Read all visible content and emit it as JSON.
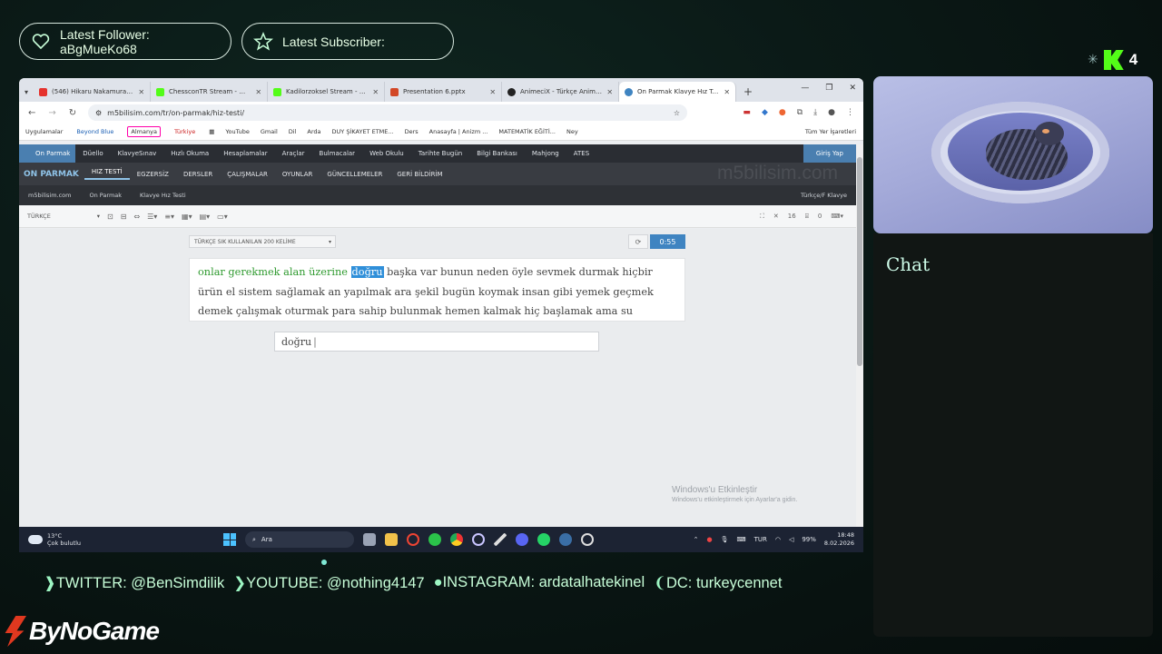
{
  "overlay": {
    "follower": {
      "label": "Latest Follower:",
      "value": "aBgMueKo68"
    },
    "subscriber": {
      "label": "Latest Subscriber:",
      "value": ""
    },
    "kick": {
      "count": "4"
    },
    "socials": [
      {
        "icon": "twitter-icon",
        "text": "TWITTER: @BenSimdilik"
      },
      {
        "icon": "youtube-icon",
        "text": "YOUTUBE: @nothing4147"
      },
      {
        "icon": "instagram-icon",
        "text": "INSTAGRAM: ardatalhatekinel"
      },
      {
        "icon": "discord-icon",
        "text": "DC: turkeycennet"
      }
    ],
    "brand": "ByNoGame",
    "chat_title": "Chat"
  },
  "browser": {
    "tabs": [
      {
        "title": "(546) Hikaru Nakamura vs",
        "color": "#e5322d"
      },
      {
        "title": "ChessconTR Stream - Wat",
        "color": "#53fc18"
      },
      {
        "title": "Kadilorzoksel Stream - Wa",
        "color": "#53fc18"
      },
      {
        "title": "Presentation 6.pptx",
        "color": "#d24726"
      },
      {
        "title": "AnimeciX - Türkçe Anime İ",
        "color": "#222222"
      },
      {
        "title": "On Parmak Klavye Hız Testi",
        "color": "#3f84c1"
      }
    ],
    "url": "m5bilisim.com/tr/on-parmak/hiz-testi/",
    "bookmarks": [
      "Uygulamalar",
      "Beyond Blue",
      "Almanya",
      "Türkiye",
      "YouTube",
      "Gmail",
      "Dil",
      "Arda",
      "DUY ŞİKAYET ETME...",
      "Ders",
      "Anasayfa | Anizm ...",
      "MATEMATİK EĞİTİ...",
      "Ney",
      "Tüm Yer İşaretleri"
    ]
  },
  "site": {
    "top_nav": [
      "On Parmak",
      "Düello",
      "KlavyeSınav",
      "Hızlı Okuma",
      "Hesaplamalar",
      "Araçlar",
      "Bulmacalar",
      "Web Okulu",
      "Tarihte Bugün",
      "Bilgi Bankası",
      "Mahjong",
      "ATES"
    ],
    "login": "Giriş Yap",
    "brand": "ON PARMAK",
    "sub_nav": [
      "HIZ TESTİ",
      "EGZERSİZ",
      "DERSLER",
      "ÇALIŞMALAR",
      "OYUNLAR",
      "GÜNCELLEMELER",
      "GERİ BİLDİRİM"
    ],
    "watermark": "m5bilisim.com",
    "breadcrumb": [
      "m5bilisim.com",
      "On Parmak",
      "Klavye Hız Testi"
    ],
    "layout": "Türkçe/F Klavye",
    "language": "TÜRKÇE",
    "font_size": "16",
    "count": "0",
    "word_set": "TÜRKÇE SIK KULLANILAN 200 KELİME",
    "timer": "0:55",
    "typed_words": [
      "onlar",
      "gerekmek",
      "alan",
      "üzerine"
    ],
    "current_word": "doğru",
    "line1_rest": "başka var bunun neden öyle sevmek durmak hiçbir",
    "line2": "ürün el sistem sağlamak an yapılmak ara şekil bugün koymak insan gibi yemek geçmek",
    "line3": "demek çalışmak oturmak para sahip bulunmak hemen kalmak hiç başlamak ama su",
    "input_value": "doğru",
    "activate_title": "Windows'u Etkinleştir",
    "activate_sub": "Windows'u etkinleştirmek için Ayarlar'a gidin."
  },
  "taskbar": {
    "temp": "13°C",
    "weather": "Çok bulutlu",
    "search": "Ara",
    "lang": "TUR",
    "battery": "99%",
    "time": "18:48",
    "date": "8.02.2026"
  }
}
